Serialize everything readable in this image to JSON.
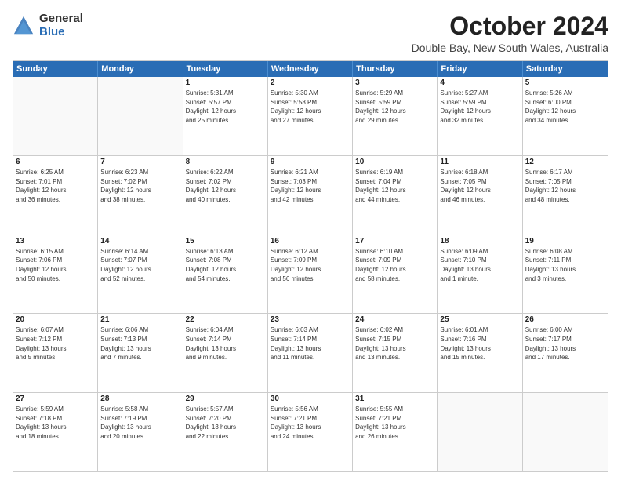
{
  "logo": {
    "general": "General",
    "blue": "Blue"
  },
  "title": "October 2024",
  "subtitle": "Double Bay, New South Wales, Australia",
  "header_days": [
    "Sunday",
    "Monday",
    "Tuesday",
    "Wednesday",
    "Thursday",
    "Friday",
    "Saturday"
  ],
  "rows": [
    [
      {
        "day": "",
        "empty": true,
        "lines": []
      },
      {
        "day": "",
        "empty": true,
        "lines": []
      },
      {
        "day": "1",
        "empty": false,
        "lines": [
          "Sunrise: 5:31 AM",
          "Sunset: 5:57 PM",
          "Daylight: 12 hours",
          "and 25 minutes."
        ]
      },
      {
        "day": "2",
        "empty": false,
        "lines": [
          "Sunrise: 5:30 AM",
          "Sunset: 5:58 PM",
          "Daylight: 12 hours",
          "and 27 minutes."
        ]
      },
      {
        "day": "3",
        "empty": false,
        "lines": [
          "Sunrise: 5:29 AM",
          "Sunset: 5:59 PM",
          "Daylight: 12 hours",
          "and 29 minutes."
        ]
      },
      {
        "day": "4",
        "empty": false,
        "lines": [
          "Sunrise: 5:27 AM",
          "Sunset: 5:59 PM",
          "Daylight: 12 hours",
          "and 32 minutes."
        ]
      },
      {
        "day": "5",
        "empty": false,
        "lines": [
          "Sunrise: 5:26 AM",
          "Sunset: 6:00 PM",
          "Daylight: 12 hours",
          "and 34 minutes."
        ]
      }
    ],
    [
      {
        "day": "6",
        "empty": false,
        "lines": [
          "Sunrise: 6:25 AM",
          "Sunset: 7:01 PM",
          "Daylight: 12 hours",
          "and 36 minutes."
        ]
      },
      {
        "day": "7",
        "empty": false,
        "lines": [
          "Sunrise: 6:23 AM",
          "Sunset: 7:02 PM",
          "Daylight: 12 hours",
          "and 38 minutes."
        ]
      },
      {
        "day": "8",
        "empty": false,
        "lines": [
          "Sunrise: 6:22 AM",
          "Sunset: 7:02 PM",
          "Daylight: 12 hours",
          "and 40 minutes."
        ]
      },
      {
        "day": "9",
        "empty": false,
        "lines": [
          "Sunrise: 6:21 AM",
          "Sunset: 7:03 PM",
          "Daylight: 12 hours",
          "and 42 minutes."
        ]
      },
      {
        "day": "10",
        "empty": false,
        "lines": [
          "Sunrise: 6:19 AM",
          "Sunset: 7:04 PM",
          "Daylight: 12 hours",
          "and 44 minutes."
        ]
      },
      {
        "day": "11",
        "empty": false,
        "lines": [
          "Sunrise: 6:18 AM",
          "Sunset: 7:05 PM",
          "Daylight: 12 hours",
          "and 46 minutes."
        ]
      },
      {
        "day": "12",
        "empty": false,
        "lines": [
          "Sunrise: 6:17 AM",
          "Sunset: 7:05 PM",
          "Daylight: 12 hours",
          "and 48 minutes."
        ]
      }
    ],
    [
      {
        "day": "13",
        "empty": false,
        "lines": [
          "Sunrise: 6:15 AM",
          "Sunset: 7:06 PM",
          "Daylight: 12 hours",
          "and 50 minutes."
        ]
      },
      {
        "day": "14",
        "empty": false,
        "lines": [
          "Sunrise: 6:14 AM",
          "Sunset: 7:07 PM",
          "Daylight: 12 hours",
          "and 52 minutes."
        ]
      },
      {
        "day": "15",
        "empty": false,
        "lines": [
          "Sunrise: 6:13 AM",
          "Sunset: 7:08 PM",
          "Daylight: 12 hours",
          "and 54 minutes."
        ]
      },
      {
        "day": "16",
        "empty": false,
        "lines": [
          "Sunrise: 6:12 AM",
          "Sunset: 7:09 PM",
          "Daylight: 12 hours",
          "and 56 minutes."
        ]
      },
      {
        "day": "17",
        "empty": false,
        "lines": [
          "Sunrise: 6:10 AM",
          "Sunset: 7:09 PM",
          "Daylight: 12 hours",
          "and 58 minutes."
        ]
      },
      {
        "day": "18",
        "empty": false,
        "lines": [
          "Sunrise: 6:09 AM",
          "Sunset: 7:10 PM",
          "Daylight: 13 hours",
          "and 1 minute."
        ]
      },
      {
        "day": "19",
        "empty": false,
        "lines": [
          "Sunrise: 6:08 AM",
          "Sunset: 7:11 PM",
          "Daylight: 13 hours",
          "and 3 minutes."
        ]
      }
    ],
    [
      {
        "day": "20",
        "empty": false,
        "lines": [
          "Sunrise: 6:07 AM",
          "Sunset: 7:12 PM",
          "Daylight: 13 hours",
          "and 5 minutes."
        ]
      },
      {
        "day": "21",
        "empty": false,
        "lines": [
          "Sunrise: 6:06 AM",
          "Sunset: 7:13 PM",
          "Daylight: 13 hours",
          "and 7 minutes."
        ]
      },
      {
        "day": "22",
        "empty": false,
        "lines": [
          "Sunrise: 6:04 AM",
          "Sunset: 7:14 PM",
          "Daylight: 13 hours",
          "and 9 minutes."
        ]
      },
      {
        "day": "23",
        "empty": false,
        "lines": [
          "Sunrise: 6:03 AM",
          "Sunset: 7:14 PM",
          "Daylight: 13 hours",
          "and 11 minutes."
        ]
      },
      {
        "day": "24",
        "empty": false,
        "lines": [
          "Sunrise: 6:02 AM",
          "Sunset: 7:15 PM",
          "Daylight: 13 hours",
          "and 13 minutes."
        ]
      },
      {
        "day": "25",
        "empty": false,
        "lines": [
          "Sunrise: 6:01 AM",
          "Sunset: 7:16 PM",
          "Daylight: 13 hours",
          "and 15 minutes."
        ]
      },
      {
        "day": "26",
        "empty": false,
        "lines": [
          "Sunrise: 6:00 AM",
          "Sunset: 7:17 PM",
          "Daylight: 13 hours",
          "and 17 minutes."
        ]
      }
    ],
    [
      {
        "day": "27",
        "empty": false,
        "lines": [
          "Sunrise: 5:59 AM",
          "Sunset: 7:18 PM",
          "Daylight: 13 hours",
          "and 18 minutes."
        ]
      },
      {
        "day": "28",
        "empty": false,
        "lines": [
          "Sunrise: 5:58 AM",
          "Sunset: 7:19 PM",
          "Daylight: 13 hours",
          "and 20 minutes."
        ]
      },
      {
        "day": "29",
        "empty": false,
        "lines": [
          "Sunrise: 5:57 AM",
          "Sunset: 7:20 PM",
          "Daylight: 13 hours",
          "and 22 minutes."
        ]
      },
      {
        "day": "30",
        "empty": false,
        "lines": [
          "Sunrise: 5:56 AM",
          "Sunset: 7:21 PM",
          "Daylight: 13 hours",
          "and 24 minutes."
        ]
      },
      {
        "day": "31",
        "empty": false,
        "lines": [
          "Sunrise: 5:55 AM",
          "Sunset: 7:21 PM",
          "Daylight: 13 hours",
          "and 26 minutes."
        ]
      },
      {
        "day": "",
        "empty": true,
        "lines": []
      },
      {
        "day": "",
        "empty": true,
        "lines": []
      }
    ]
  ]
}
